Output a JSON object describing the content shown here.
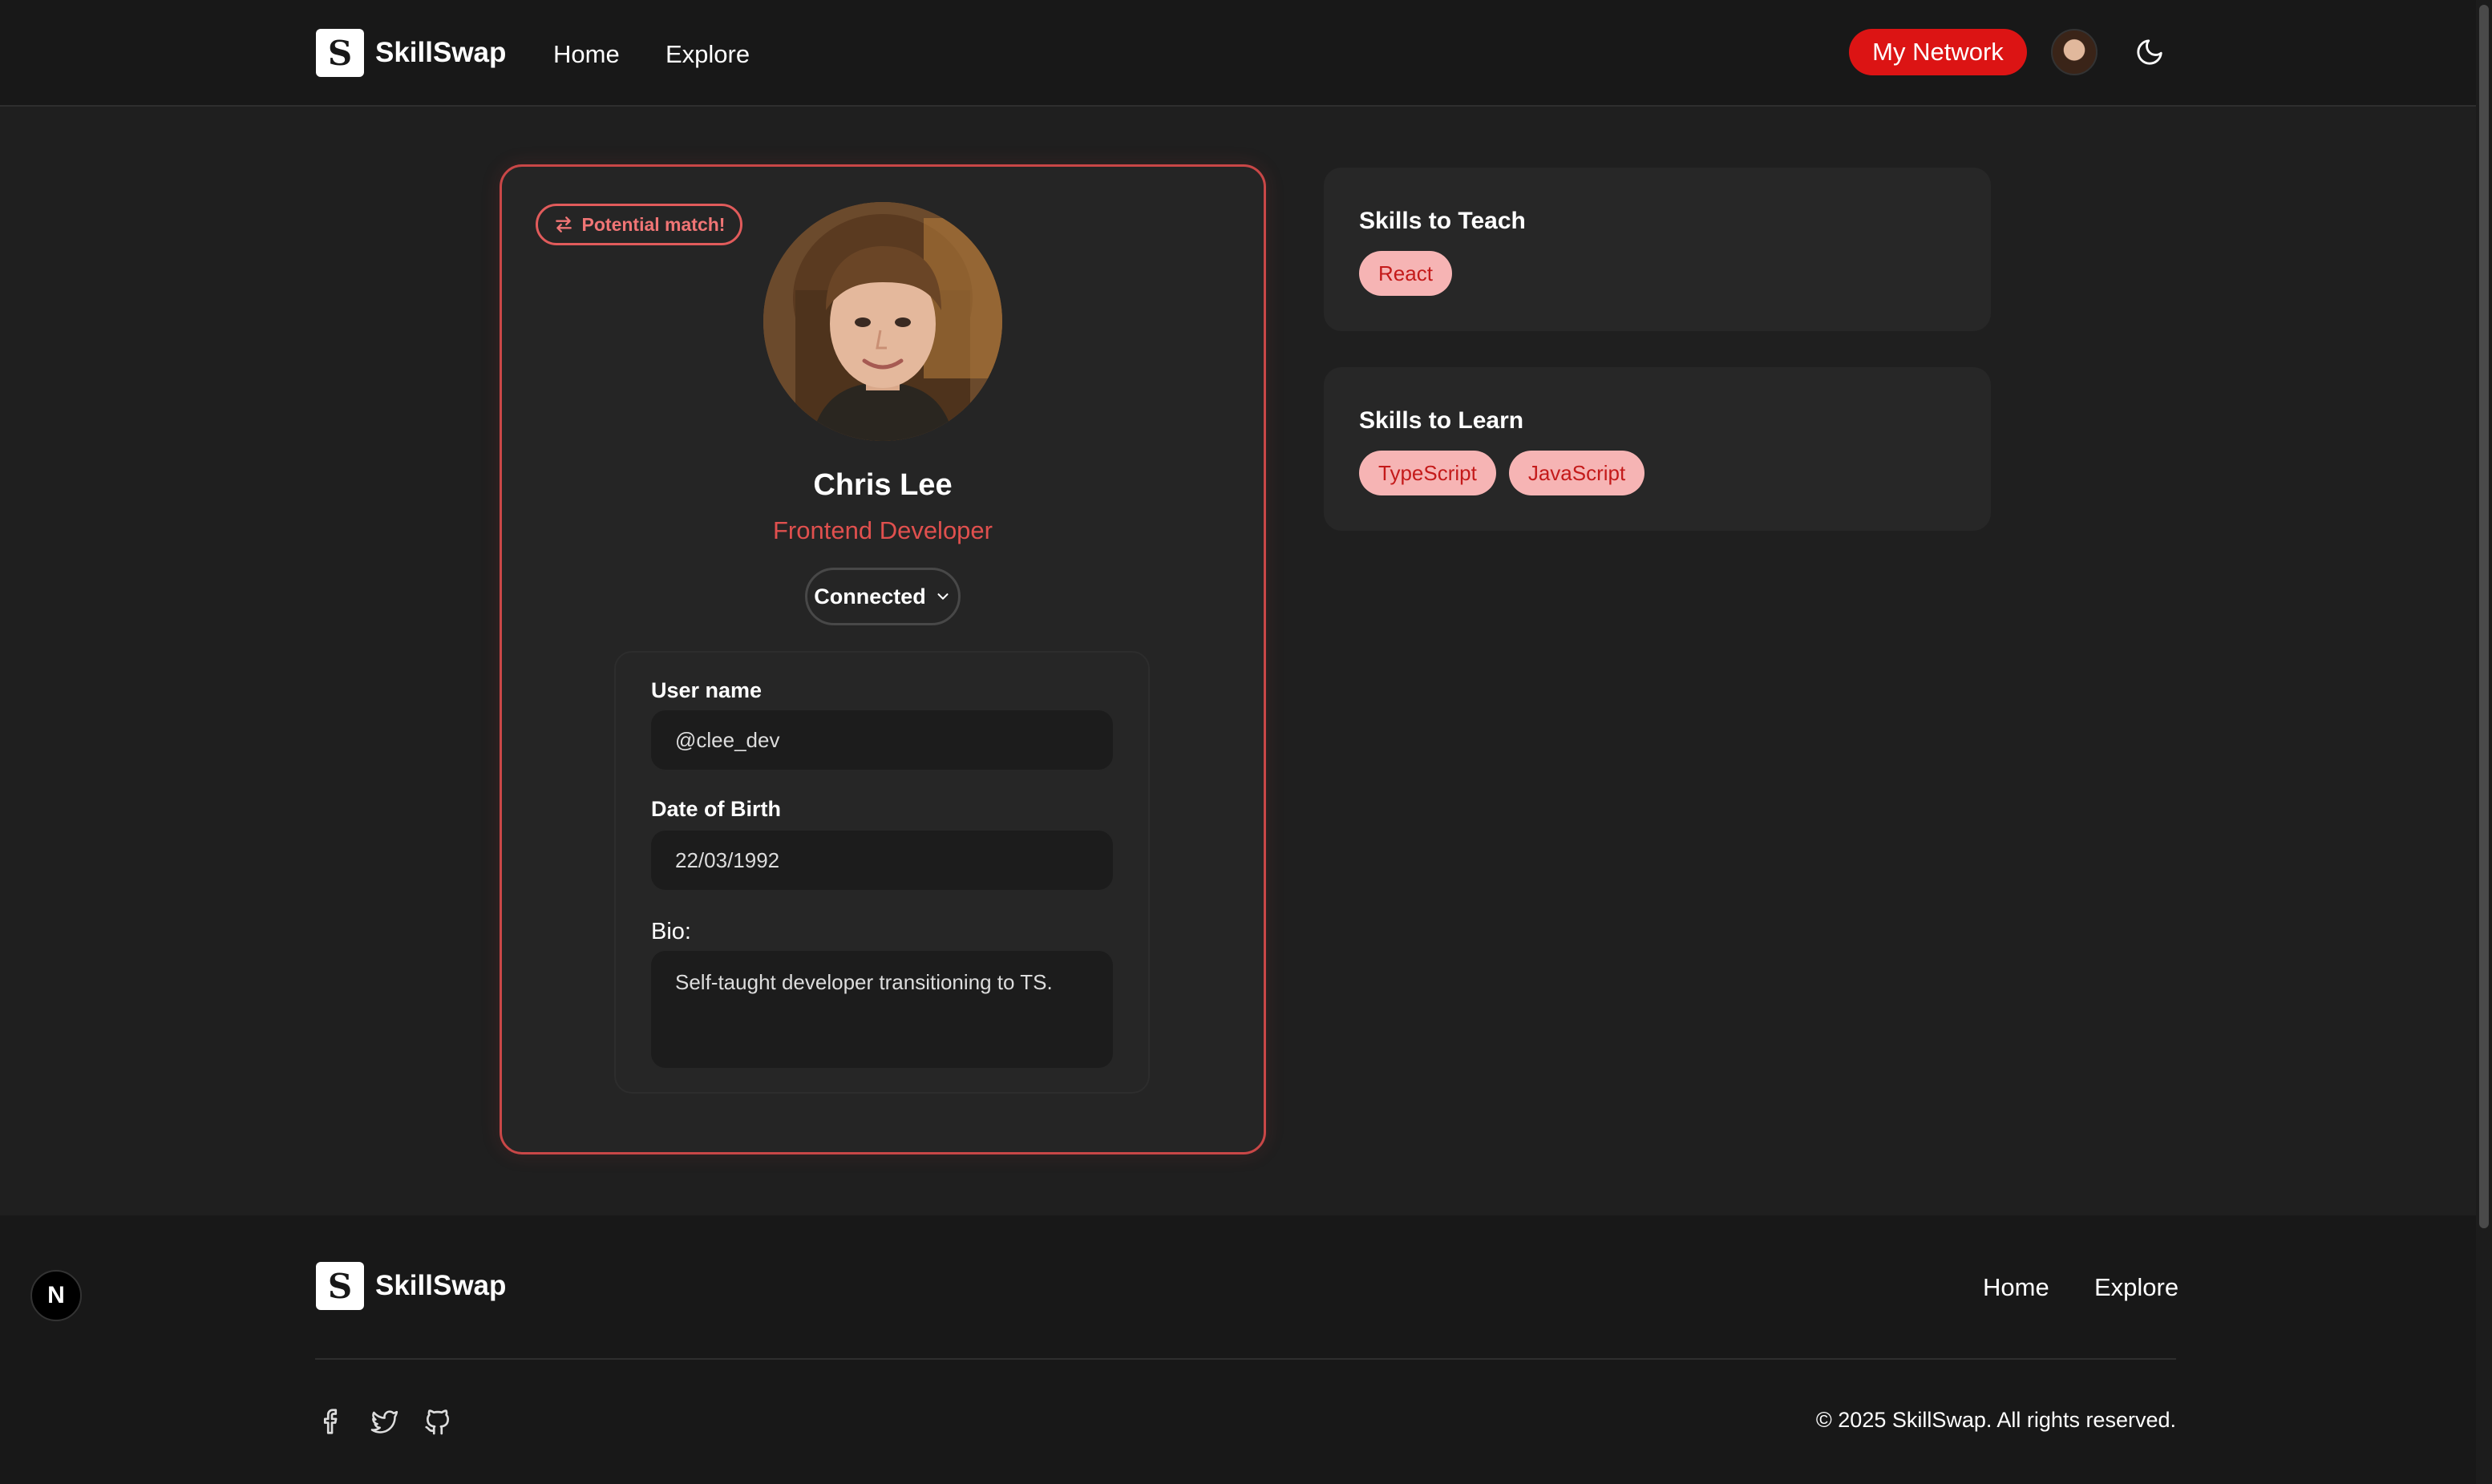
{
  "brand": {
    "logo_letter": "S",
    "name": "SkillSwap"
  },
  "nav": {
    "home": "Home",
    "explore": "Explore",
    "my_network": "My Network"
  },
  "profile": {
    "badge": "Potential match!",
    "name": "Chris Lee",
    "role": "Frontend Developer",
    "connection_status": "Connected",
    "username_label": "User name",
    "username": "@clee_dev",
    "dob_label": "Date of Birth",
    "dob": "22/03/1992",
    "bio_label": "Bio:",
    "bio": "Self-taught developer transitioning to TS."
  },
  "skills_teach": {
    "title": "Skills to Teach",
    "items": [
      "React"
    ]
  },
  "skills_learn": {
    "title": "Skills to Learn",
    "items": [
      "TypeScript",
      "JavaScript"
    ]
  },
  "footer": {
    "brand": "SkillSwap",
    "links": {
      "home": "Home",
      "explore": "Explore"
    },
    "copyright": "© 2025 SkillSwap. All rights reserved.",
    "social_icons": [
      "facebook-icon",
      "twitter-icon",
      "github-icon"
    ]
  },
  "dev_badge": "N",
  "colors": {
    "accent": "#dc1414",
    "accent_text": "#e0504e",
    "chip_bg": "#f6b4b4",
    "chip_text": "#c41a1a",
    "background": "#1f1f1f",
    "header_bg": "#181818",
    "card_bg": "#272727"
  }
}
